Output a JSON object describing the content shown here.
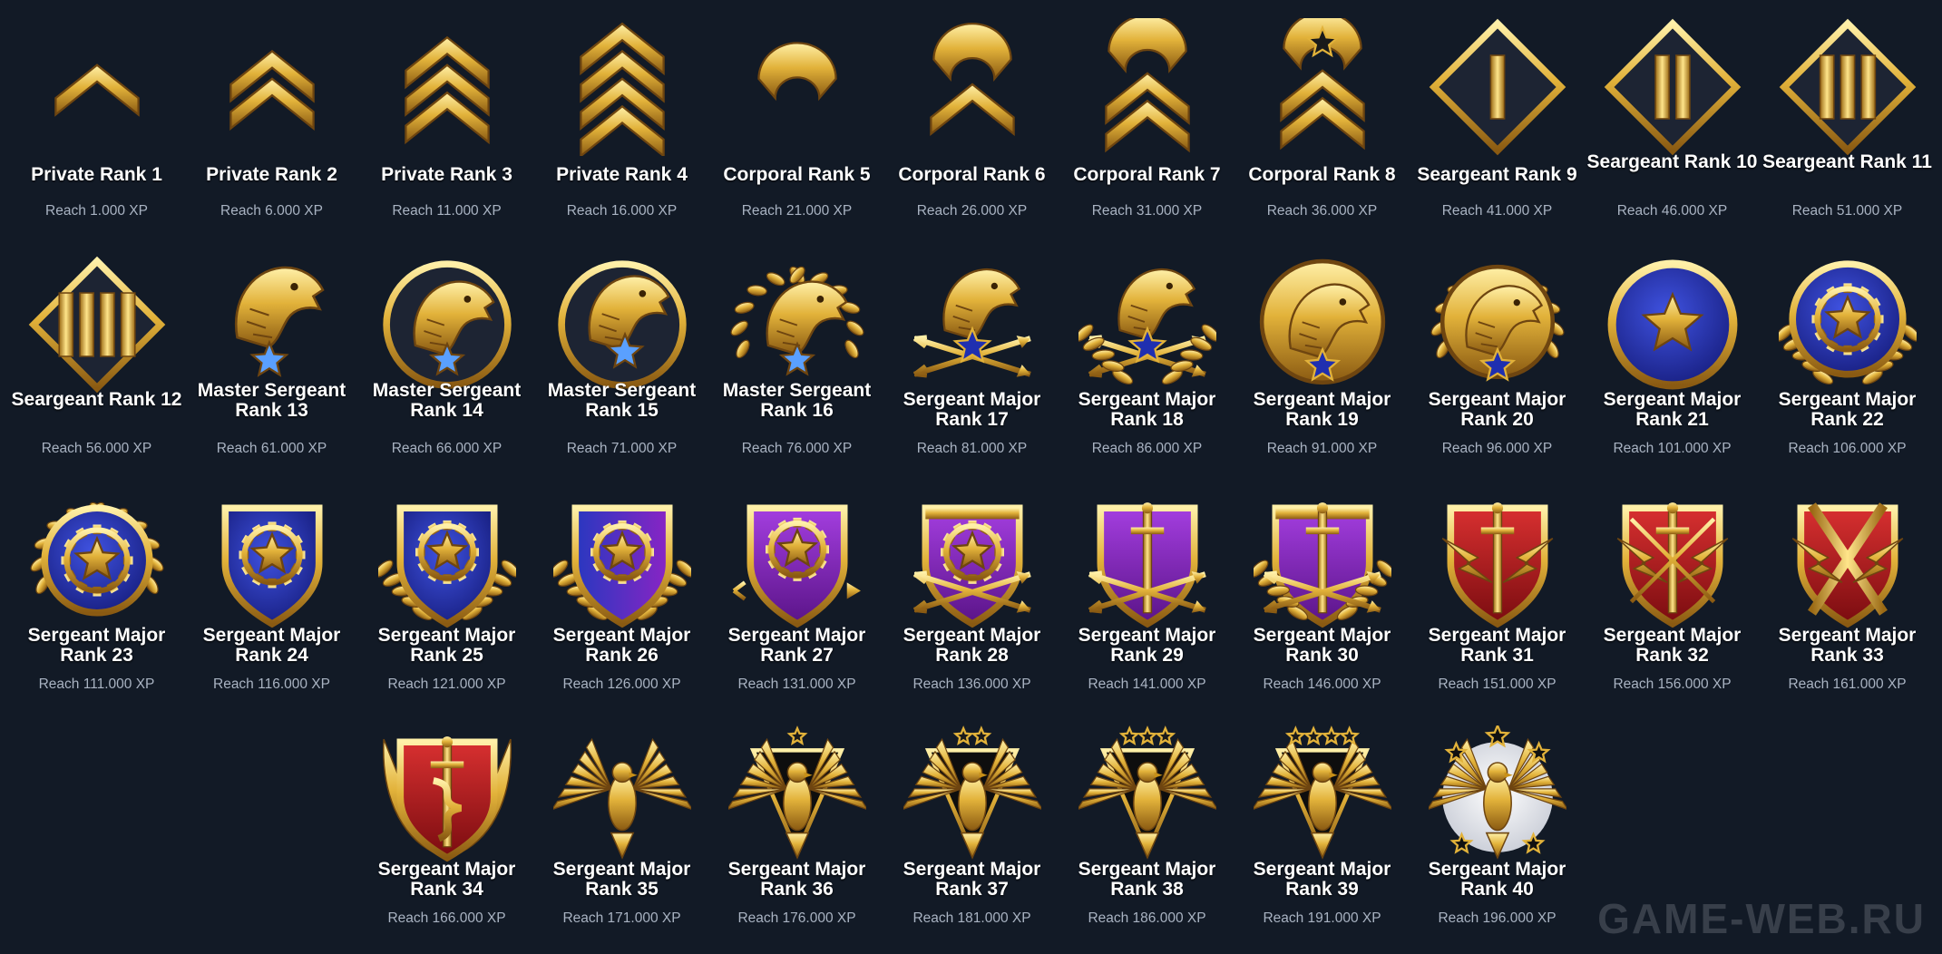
{
  "watermark": "GAME-WEB.RU",
  "colors": {
    "background": "#121a26",
    "gold": "#e2b23a",
    "gold_dark": "#8a5a12",
    "blue": "#2431a8",
    "purple": "#7d22b8",
    "red": "#b01d22",
    "label": "#ffffff",
    "xp": "#a9b3c2"
  },
  "ranks": [
    {
      "label": "Private Rank 1",
      "xp": "Reach 1.000 XP",
      "icon": "chevron-1-icon"
    },
    {
      "label": "Private Rank 2",
      "xp": "Reach 6.000 XP",
      "icon": "chevron-2-icon"
    },
    {
      "label": "Private Rank 3",
      "xp": "Reach 11.000 XP",
      "icon": "chevron-3-icon"
    },
    {
      "label": "Private Rank 4",
      "xp": "Reach 16.000 XP",
      "icon": "chevron-4-icon"
    },
    {
      "label": "Corporal Rank 5",
      "xp": "Reach 21.000 XP",
      "icon": "rocker-icon"
    },
    {
      "label": "Corporal Rank 6",
      "xp": "Reach 26.000 XP",
      "icon": "rocker-chevron-1-icon"
    },
    {
      "label": "Corporal Rank 7",
      "xp": "Reach 31.000 XP",
      "icon": "rocker-chevron-2-icon"
    },
    {
      "label": "Corporal Rank 8",
      "xp": "Reach 36.000 XP",
      "icon": "rocker-star-chevron-icon"
    },
    {
      "label": "Seargeant Rank 9",
      "xp": "Reach 41.000 XP",
      "icon": "diamond-bar-1-icon"
    },
    {
      "label": "Seargeant Rank 10",
      "xp": "Reach 46.000 XP",
      "icon": "diamond-bar-2-icon"
    },
    {
      "label": "Seargeant Rank 11",
      "xp": "Reach 51.000 XP",
      "icon": "diamond-bar-3-icon"
    },
    {
      "label": "Seargeant Rank 12",
      "xp": "Reach 56.000 XP",
      "icon": "diamond-bar-4-icon"
    },
    {
      "label": "Master Sergeant Rank 13",
      "xp": "Reach 61.000 XP",
      "icon": "eagle-star-icon"
    },
    {
      "label": "Master Sergeant Rank 14",
      "xp": "Reach 66.000 XP",
      "icon": "eagle-ring-icon"
    },
    {
      "label": "Master Sergeant Rank 15",
      "xp": "Reach 71.000 XP",
      "icon": "eagle-ring-star-icon"
    },
    {
      "label": "Master Sergeant Rank 16",
      "xp": "Reach 76.000 XP",
      "icon": "eagle-laurel-icon"
    },
    {
      "label": "Sergeant Major Rank 17",
      "xp": "Reach 81.000 XP",
      "icon": "eagle-arrows-icon"
    },
    {
      "label": "Sergeant Major Rank 18",
      "xp": "Reach 86.000 XP",
      "icon": "eagle-arrows-laurel-icon"
    },
    {
      "label": "Sergeant Major Rank 19",
      "xp": "Reach 91.000 XP",
      "icon": "eagle-medal-icon"
    },
    {
      "label": "Sergeant Major Rank 20",
      "xp": "Reach 96.000 XP",
      "icon": "eagle-medal-laurel-icon"
    },
    {
      "label": "Sergeant Major Rank 21",
      "xp": "Reach 101.000 XP",
      "icon": "blue-star-medal-icon"
    },
    {
      "label": "Sergeant Major Rank 22",
      "xp": "Reach 106.000 XP",
      "icon": "blue-gear-medal-laurel-icon"
    },
    {
      "label": "Sergeant Major Rank 23",
      "xp": "Reach 111.000 XP",
      "icon": "blue-gear-medal-wreath-icon"
    },
    {
      "label": "Sergeant Major Rank 24",
      "xp": "Reach 116.000 XP",
      "icon": "blue-shield-icon"
    },
    {
      "label": "Sergeant Major Rank 25",
      "xp": "Reach 121.000 XP",
      "icon": "blue-shield-laurel-icon"
    },
    {
      "label": "Sergeant Major Rank 26",
      "xp": "Reach 126.000 XP",
      "icon": "blue-purple-shield-icon"
    },
    {
      "label": "Sergeant Major Rank 27",
      "xp": "Reach 131.000 XP",
      "icon": "purple-shield-arrow-icon"
    },
    {
      "label": "Sergeant Major Rank 28",
      "xp": "Reach 136.000 XP",
      "icon": "purple-shield-arrows-icon"
    },
    {
      "label": "Sergeant Major Rank 29",
      "xp": "Reach 141.000 XP",
      "icon": "purple-shield-sword-icon"
    },
    {
      "label": "Sergeant Major Rank 30",
      "xp": "Reach 146.000 XP",
      "icon": "purple-shield-sword-laurel-icon"
    },
    {
      "label": "Sergeant Major Rank 31",
      "xp": "Reach 151.000 XP",
      "icon": "red-shield-lightning-icon"
    },
    {
      "label": "Sergeant Major Rank 32",
      "xp": "Reach 156.000 XP",
      "icon": "red-shield-swords-icon"
    },
    {
      "label": "Sergeant Major Rank 33",
      "xp": "Reach 161.000 XP",
      "icon": "red-shield-crossed-swords-icon"
    },
    {
      "label": "Sergeant Major Rank 34",
      "xp": "Reach 166.000 XP",
      "icon": "red-shield-snake-wings-icon"
    },
    {
      "label": "Sergeant Major Rank 35",
      "xp": "Reach 171.000 XP",
      "icon": "spread-eagle-icon"
    },
    {
      "label": "Sergeant Major Rank 36",
      "xp": "Reach 176.000 XP",
      "icon": "spread-eagle-1-star-icon"
    },
    {
      "label": "Sergeant Major Rank 37",
      "xp": "Reach 181.000 XP",
      "icon": "spread-eagle-2-stars-icon"
    },
    {
      "label": "Sergeant Major Rank 38",
      "xp": "Reach 186.000 XP",
      "icon": "spread-eagle-3-stars-icon"
    },
    {
      "label": "Sergeant Major Rank 39",
      "xp": "Reach 191.000 XP",
      "icon": "spread-eagle-4-stars-icon"
    },
    {
      "label": "Sergeant Major Rank 40",
      "xp": "Reach 196.000 XP",
      "icon": "spread-eagle-5-stars-icon"
    }
  ]
}
